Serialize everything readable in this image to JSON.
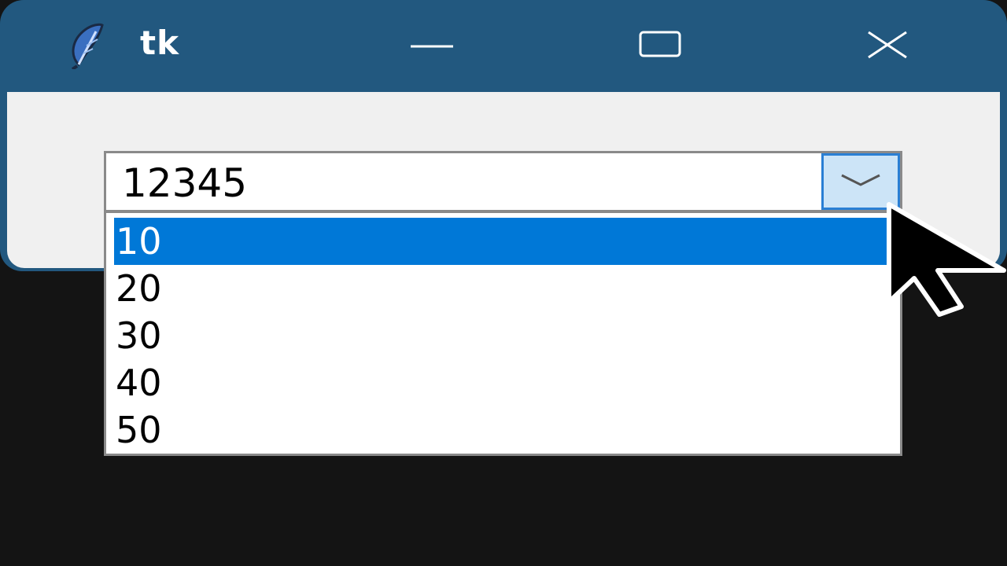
{
  "window": {
    "title": "tk",
    "controls": {
      "minimize_icon": "minimize-icon",
      "maximize_icon": "maximize-icon",
      "close_icon": "close-icon"
    },
    "titlebar_color": "#22587f"
  },
  "combobox": {
    "value": "12345",
    "button_icon": "chevron-down-icon",
    "options": [
      "10",
      "20",
      "30",
      "40",
      "50"
    ],
    "highlighted": "10",
    "highlight_color": "#0078d7"
  }
}
